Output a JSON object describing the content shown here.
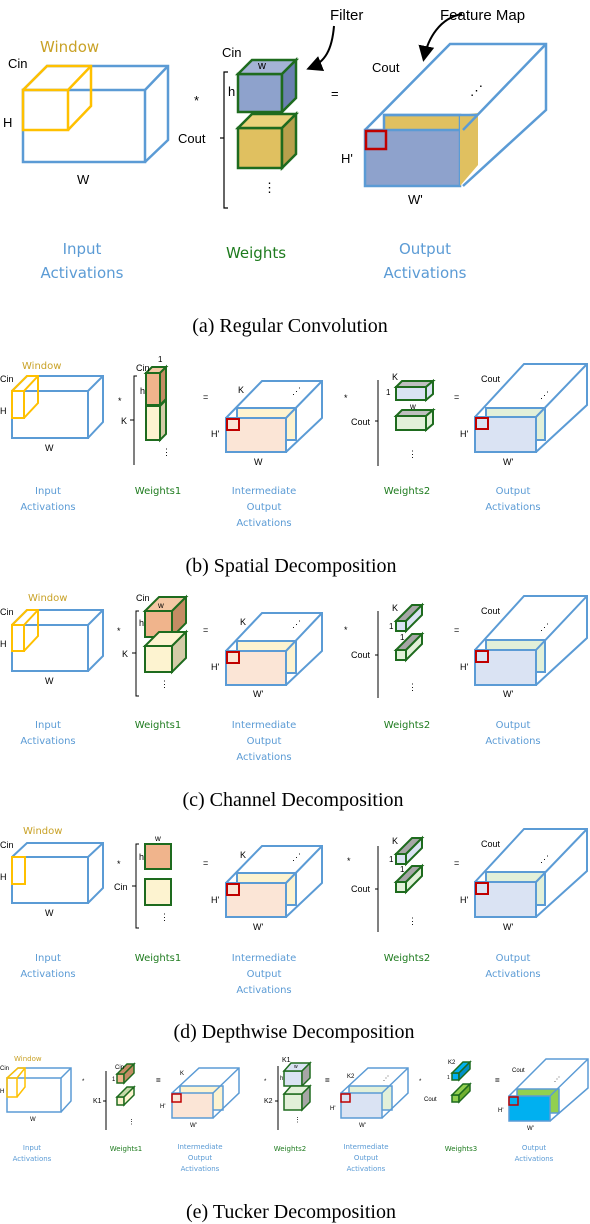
{
  "colors": {
    "blue": "#5b9bd5",
    "window": "#ffc000",
    "window_text": "#c9a227",
    "green": "#1e6b1e",
    "green_text": "#1e7b1e",
    "red": "#c00000",
    "filter_blue": "#8ea2cc",
    "filter_gold": "#e0c060",
    "peach": "#f0b48c",
    "cream": "#fdf3d0",
    "pale_green": "#e2f0d9",
    "pale_blue": "#dae3f3",
    "cyan": "#00b0f0",
    "lime": "#92d050"
  },
  "panel_a": {
    "caption": "(a) Regular Convolution",
    "window_label": "Window",
    "input": {
      "cin": "Cin",
      "h": "H",
      "w": "W",
      "caption_line1": "Input",
      "caption_line2": "Activations"
    },
    "op_conv": "*",
    "op_eq": "=",
    "weights": {
      "cin": "Cin",
      "w": "w",
      "h": "h",
      "cout": "Cout",
      "dots": "⋮",
      "caption": "Weights"
    },
    "filter_callout": "Filter",
    "feature_map_callout": "Feature Map",
    "output": {
      "cout": "Cout",
      "h": "H'",
      "w": "W'",
      "dots": "⋰",
      "caption_line1": "Output",
      "caption_line2": "Activations"
    }
  },
  "panel_b": {
    "caption": "(b) Spatial Decomposition",
    "window_label": "Window",
    "input": {
      "cin": "Cin",
      "h": "H",
      "w": "W",
      "caption_line1": "Input",
      "caption_line2": "Activations"
    },
    "weights1": {
      "one": "1",
      "cin": "Cin",
      "h": "h",
      "k": "K",
      "dots": "⋮",
      "caption": "Weights1"
    },
    "inter": {
      "k": "K",
      "h": "H'",
      "w": "W",
      "dots": "⋰",
      "caption_line1": "Intermediate",
      "caption_line2": "Output",
      "caption_line3": "Activations"
    },
    "weights2": {
      "k": "K",
      "one": "1",
      "w": "w",
      "cout": "Cout",
      "dots": "⋮",
      "caption": "Weights2"
    },
    "output": {
      "cout": "Cout",
      "h": "H'",
      "w": "W'",
      "dots": "⋰",
      "caption_line1": "Output",
      "caption_line2": "Activations"
    },
    "op_conv": "*",
    "op_eq": "="
  },
  "panel_c": {
    "caption": "(c) Channel Decomposition",
    "window_label": "Window",
    "input": {
      "cin": "Cin",
      "h": "H",
      "w": "W",
      "caption_line1": "Input",
      "caption_line2": "Activations"
    },
    "weights1": {
      "cin": "Cin",
      "w": "w",
      "h": "h",
      "k": "K",
      "dots": "⋮",
      "caption": "Weights1"
    },
    "inter": {
      "k": "K",
      "h": "H'",
      "w": "W'",
      "dots": "⋰",
      "caption_line1": "Intermediate",
      "caption_line2": "Output",
      "caption_line3": "Activations"
    },
    "weights2": {
      "k": "K",
      "one": "1",
      "one_b": "1",
      "cout": "Cout",
      "dots": "⋮",
      "caption": "Weights2"
    },
    "output": {
      "cout": "Cout",
      "h": "H'",
      "w": "W'",
      "dots": "⋰",
      "caption_line1": "Output",
      "caption_line2": "Activations"
    },
    "op_conv": "*",
    "op_eq": "="
  },
  "panel_d": {
    "caption": "(d) Depthwise Decomposition",
    "window_label": "Window",
    "input": {
      "cin": "Cin",
      "h": "H",
      "w": "W",
      "caption_line1": "Input",
      "caption_line2": "Activations"
    },
    "weights1": {
      "w": "w",
      "h": "h",
      "cin": "Cin",
      "dots": "⋮",
      "caption": "Weights1"
    },
    "inter": {
      "k": "K",
      "h": "H'",
      "w": "W'",
      "dots": "⋰",
      "caption_line1": "Intermediate",
      "caption_line2": "Output",
      "caption_line3": "Activations"
    },
    "weights2": {
      "k": "K",
      "one": "1",
      "one_b": "1",
      "cout": "Cout",
      "dots": "⋮",
      "caption": "Weights2"
    },
    "output": {
      "cout": "Cout",
      "h": "H'",
      "w": "W'",
      "dots": "⋰",
      "caption_line1": "Output",
      "caption_line2": "Activations"
    },
    "op_conv": "*",
    "op_eq": "="
  },
  "panel_e": {
    "caption": "(e) Tucker Decomposition",
    "window_label": "Window",
    "input": {
      "cin": "Cin",
      "h": "H",
      "w": "W",
      "caption_line1": "Input",
      "caption_line2": "Activations"
    },
    "weights1": {
      "cin": "Cin",
      "one": "1",
      "k1": "K1",
      "dots": "⋮",
      "caption": "Weights1"
    },
    "inter1": {
      "k": "K",
      "h": "H'",
      "w": "W'",
      "caption_line1": "Intermediate",
      "caption_line2": "Output",
      "caption_line3": "Activations"
    },
    "weights2": {
      "k1": "K1",
      "w": "w",
      "h": "h",
      "k2": "K2",
      "dots": "⋮",
      "caption": "Weights2"
    },
    "inter2": {
      "k2": "K2",
      "h": "H'",
      "w": "W'",
      "dots": "⋰",
      "caption_line1": "Intermediate",
      "caption_line2": "Output",
      "caption_line3": "Activations"
    },
    "weights3": {
      "k2": "K2",
      "one": "1",
      "cout": "Cout",
      "caption": "Weights3"
    },
    "output": {
      "cout": "Cout",
      "h": "H'",
      "w": "W'",
      "dots": "⋰",
      "caption_line1": "Output",
      "caption_line2": "Activations"
    },
    "op_conv": "*",
    "op_eq": "="
  }
}
